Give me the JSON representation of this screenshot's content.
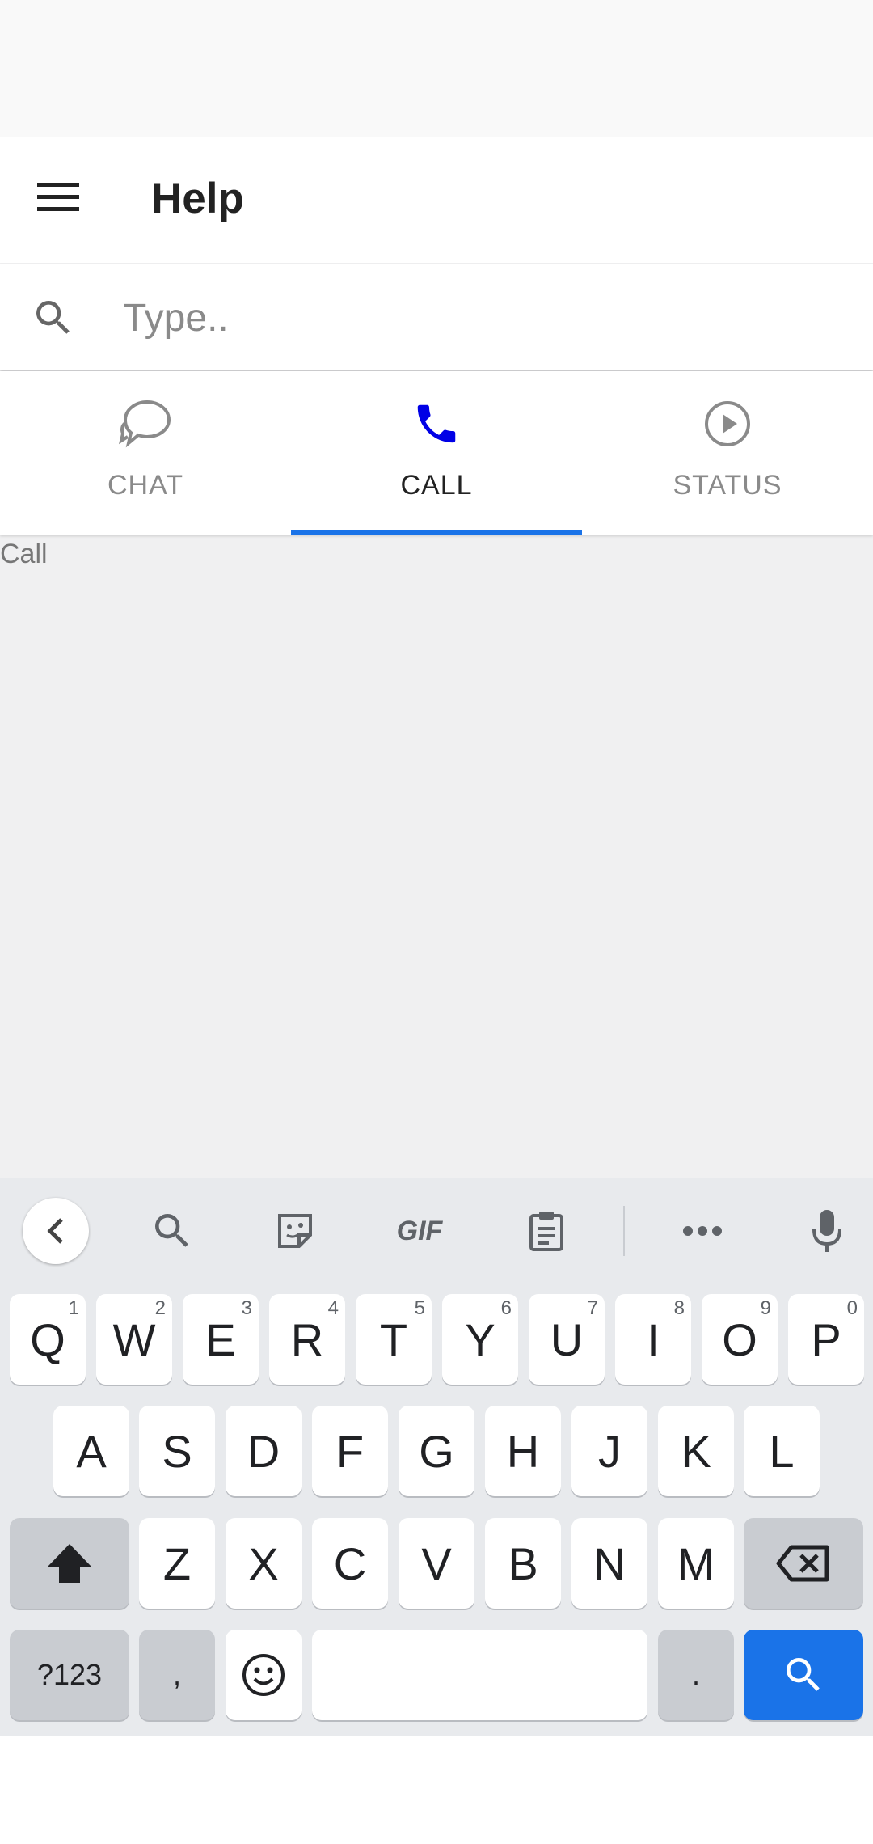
{
  "app_bar": {
    "title": "Help",
    "menu_icon": "hamburger-menu-icon"
  },
  "search": {
    "placeholder": "Type..",
    "value": "",
    "icon": "search-icon"
  },
  "tabs": [
    {
      "label": "CHAT",
      "icon": "chat-bubble-icon",
      "active": false
    },
    {
      "label": "CALL",
      "icon": "phone-icon",
      "active": true
    },
    {
      "label": "STATUS",
      "icon": "play-circle-icon",
      "active": false
    }
  ],
  "content": {
    "label": "Call"
  },
  "colors": {
    "accent": "#1a73e8",
    "call_icon": "#0000e6",
    "tab_inactive": "#8a8a8a"
  },
  "keyboard": {
    "toolbar": [
      "back-chevron-icon",
      "search-icon",
      "sticker-icon",
      "gif-icon",
      "clipboard-icon",
      "more-icon",
      "microphone-icon"
    ],
    "gif_label": "GIF",
    "row1": [
      "Q",
      "W",
      "E",
      "R",
      "T",
      "Y",
      "U",
      "I",
      "O",
      "P"
    ],
    "row1_hints": [
      "1",
      "2",
      "3",
      "4",
      "5",
      "6",
      "7",
      "8",
      "9",
      "0"
    ],
    "row2": [
      "A",
      "S",
      "D",
      "F",
      "G",
      "H",
      "J",
      "K",
      "L"
    ],
    "row3": [
      "Z",
      "X",
      "C",
      "V",
      "B",
      "N",
      "M"
    ],
    "symbols_label": "?123",
    "comma": ",",
    "period": "."
  }
}
